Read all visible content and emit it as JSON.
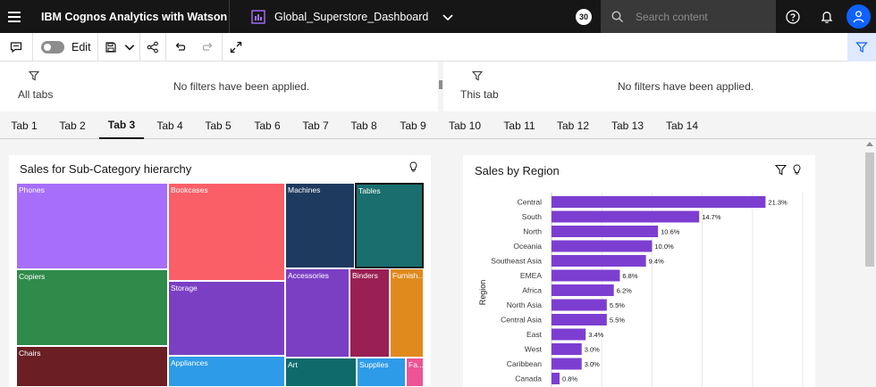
{
  "topbar": {
    "app_title": "IBM Cognos Analytics with Watson",
    "dashboard_name": "Global_Superstore_Dashboard",
    "notification_ring": "30",
    "search_placeholder": "Search content"
  },
  "toolbar": {
    "edit_label": "Edit"
  },
  "filters": {
    "all_tabs_label": "All tabs",
    "all_tabs_message": "No filters have been applied.",
    "this_tab_label": "This tab",
    "this_tab_message": "No filters have been applied."
  },
  "tabs": [
    {
      "label": "Tab 1"
    },
    {
      "label": "Tab 2"
    },
    {
      "label": "Tab 3"
    },
    {
      "label": "Tab 4"
    },
    {
      "label": "Tab 5"
    },
    {
      "label": "Tab 6"
    },
    {
      "label": "Tab 7"
    },
    {
      "label": "Tab 8"
    },
    {
      "label": "Tab 9"
    },
    {
      "label": "Tab 10"
    },
    {
      "label": "Tab 11"
    },
    {
      "label": "Tab 12"
    },
    {
      "label": "Tab 13"
    },
    {
      "label": "Tab 14"
    }
  ],
  "active_tab": "Tab 3",
  "treemap": {
    "title": "Sales for Sub-Category hierarchy",
    "tiles": [
      {
        "label": "Phones",
        "color": "#a66efa"
      },
      {
        "label": "Copiers",
        "color": "#2e8b4a"
      },
      {
        "label": "Chairs",
        "color": "#6b1e23"
      },
      {
        "label": "Bookcases",
        "color": "#fa5f68"
      },
      {
        "label": "Storage",
        "color": "#7b3fc4"
      },
      {
        "label": "Appliances",
        "color": "#2d9be8"
      },
      {
        "label": "Machines",
        "color": "#1f3a5f"
      },
      {
        "label": "Tables",
        "color": "#1a6e6e"
      },
      {
        "label": "Accessories",
        "color": "#7b3fc4"
      },
      {
        "label": "Binders",
        "color": "#9a1f52"
      },
      {
        "label": "Furnish...",
        "color": "#e08a1e"
      },
      {
        "label": "Art",
        "color": "#0f6b6b"
      },
      {
        "label": "Supplies",
        "color": "#2d9be8"
      },
      {
        "label": "Fa...",
        "color": "#ee5396"
      }
    ]
  },
  "chart_data": {
    "type": "bar",
    "title": "Sales by Region",
    "ylabel": "Region",
    "orientation": "horizontal",
    "categories": [
      "Central",
      "South",
      "North",
      "Oceania",
      "Southeast Asia",
      "EMEA",
      "Africa",
      "North Asia",
      "Central Asia",
      "East",
      "West",
      "Caribbean",
      "Canada"
    ],
    "values": [
      21.3,
      14.7,
      10.6,
      10.0,
      9.4,
      6.8,
      6.2,
      5.5,
      5.5,
      3.4,
      3.0,
      3.0,
      0.8
    ],
    "value_labels": [
      "21.3%",
      "14.7%",
      "10.6%",
      "10.0%",
      "9.4%",
      "6.8%",
      "6.2%",
      "5.5%",
      "5.5%",
      "3.4%",
      "3.0%",
      "3.0%",
      "0.8%"
    ],
    "bar_color": "#7c3ed1",
    "xlim": [
      0,
      25
    ],
    "grid": true
  }
}
